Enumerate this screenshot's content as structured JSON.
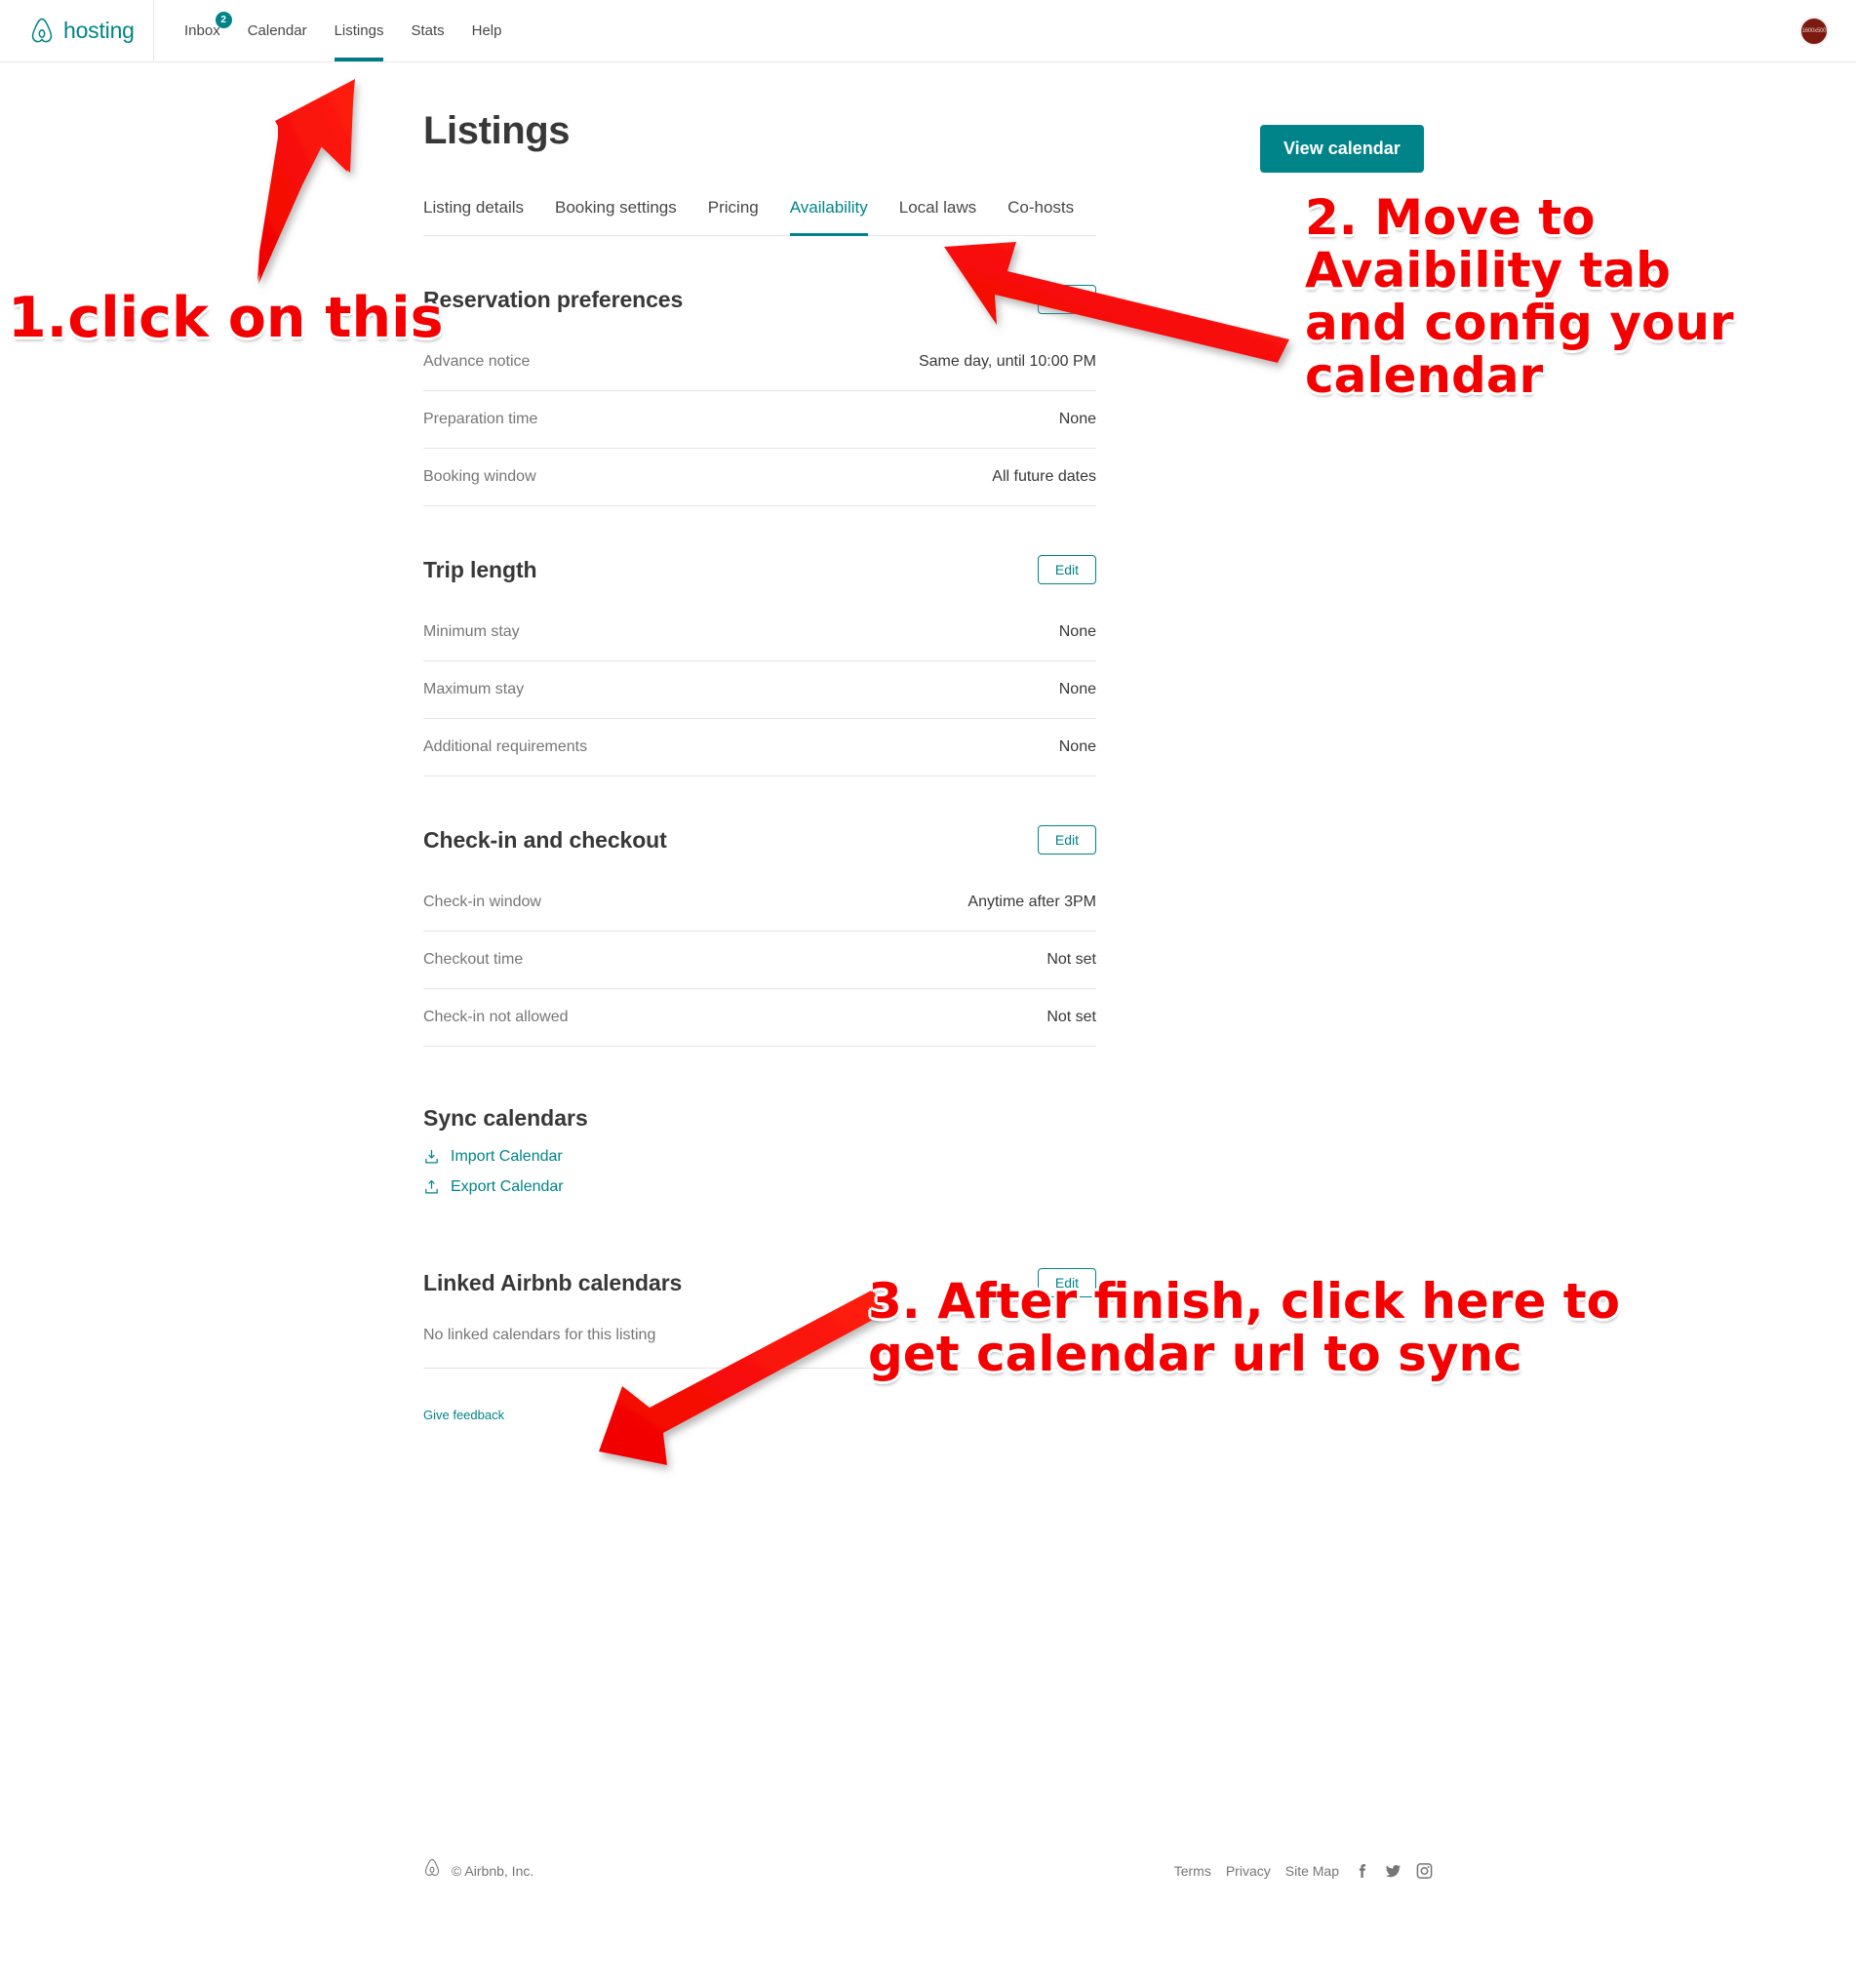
{
  "colors": {
    "brand_teal": "#008489",
    "tab_active": "#008489",
    "annotation_red": "#f40000",
    "avatar_bg": "#7c1a11",
    "text_dark": "#383838",
    "text_muted": "#767676"
  },
  "header": {
    "brand_label": "hosting",
    "brand_icon": "airbnb-belo-icon",
    "nav": [
      {
        "label": "Inbox",
        "badge": "2",
        "active": false
      },
      {
        "label": "Calendar",
        "badge": null,
        "active": false
      },
      {
        "label": "Listings",
        "badge": null,
        "active": true
      },
      {
        "label": "Stats",
        "badge": null,
        "active": false
      },
      {
        "label": "Help",
        "badge": null,
        "active": false
      }
    ],
    "avatar_text": "1600x500"
  },
  "page": {
    "title": "Listings",
    "view_calendar_label": "View calendar",
    "tabs": [
      {
        "label": "Listing details",
        "active": false
      },
      {
        "label": "Booking settings",
        "active": false
      },
      {
        "label": "Pricing",
        "active": false
      },
      {
        "label": "Availability",
        "active": true
      },
      {
        "label": "Local laws",
        "active": false
      },
      {
        "label": "Co-hosts",
        "active": false
      }
    ]
  },
  "sections": {
    "reservation_preferences": {
      "title": "Reservation preferences",
      "edit_label": "Edit",
      "rows": [
        {
          "label": "Advance notice",
          "value": "Same day, until 10:00 PM"
        },
        {
          "label": "Preparation time",
          "value": "None"
        },
        {
          "label": "Booking window",
          "value": "All future dates"
        }
      ]
    },
    "trip_length": {
      "title": "Trip length",
      "edit_label": "Edit",
      "rows": [
        {
          "label": "Minimum stay",
          "value": "None"
        },
        {
          "label": "Maximum stay",
          "value": "None"
        },
        {
          "label": "Additional requirements",
          "value": "None"
        }
      ]
    },
    "checkin_checkout": {
      "title": "Check-in and checkout",
      "edit_label": "Edit",
      "rows": [
        {
          "label": "Check-in window",
          "value": "Anytime after 3PM"
        },
        {
          "label": "Checkout time",
          "value": "Not set"
        },
        {
          "label": "Check-in not allowed",
          "value": "Not set"
        }
      ]
    },
    "sync_calendars": {
      "title": "Sync calendars",
      "import_label": "Import Calendar",
      "import_icon": "import-tray-icon",
      "export_label": "Export Calendar",
      "export_icon": "export-tray-icon"
    },
    "linked_calendars": {
      "title": "Linked Airbnb calendars",
      "edit_label": "Edit",
      "empty_text": "No linked calendars for this listing"
    },
    "feedback_label": "Give feedback"
  },
  "footer": {
    "logo_icon": "airbnb-belo-icon",
    "copyright": "© Airbnb, Inc.",
    "links": [
      "Terms",
      "Privacy",
      "Site Map"
    ],
    "social": [
      "facebook-icon",
      "twitter-icon",
      "instagram-icon"
    ]
  },
  "annotations": [
    {
      "id": "1",
      "text": "1.click on this",
      "arrow": "points up-right to Listings nav tab"
    },
    {
      "id": "2",
      "text": "2. Move to\nAvaibility tab\nand config your\ncalendar",
      "arrow": "points up-left to Availability tab"
    },
    {
      "id": "3",
      "text": "3. After finish, click here to\nget calendar url to sync",
      "arrow": "points down-left to Export Calendar"
    }
  ]
}
